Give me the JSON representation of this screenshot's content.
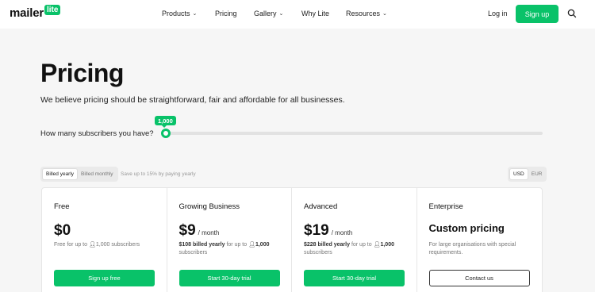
{
  "brand": {
    "word": "mailer",
    "badge": "lite",
    "accent": "#09c269"
  },
  "nav": {
    "items": [
      {
        "label": "Products",
        "dropdown": true
      },
      {
        "label": "Pricing",
        "dropdown": false
      },
      {
        "label": "Gallery",
        "dropdown": true
      },
      {
        "label": "Why Lite",
        "dropdown": false
      },
      {
        "label": "Resources",
        "dropdown": true
      }
    ],
    "login": "Log in",
    "signup": "Sign up",
    "search_icon": "search-icon"
  },
  "hero": {
    "title": "Pricing",
    "subtitle": "We believe pricing should be straightforward, fair and affordable for all businesses."
  },
  "slider": {
    "label": "How many subscribers you have?",
    "value": "1,000",
    "position_fraction": 0
  },
  "billing": {
    "options": [
      "Billed yearly",
      "Billed monthly"
    ],
    "selected": "Billed yearly",
    "note": "Save up to 15% by paying yearly"
  },
  "currency": {
    "options": [
      "USD",
      "EUR"
    ],
    "selected": "USD"
  },
  "plans": [
    {
      "name": "Free",
      "price": "$0",
      "period": "",
      "desc_prefix": "Free for up to",
      "desc_count": "1,000",
      "desc_suffix": "subscribers",
      "cta": "Sign up free"
    },
    {
      "name": "Growing Business",
      "price": "$9",
      "period": "/ month",
      "desc_prefix": "$108 billed yearly",
      "desc_mid": "for up to",
      "desc_count": "1,000",
      "desc_suffix": "subscribers",
      "cta": "Start 30-day trial"
    },
    {
      "name": "Advanced",
      "price": "$19",
      "period": "/ month",
      "desc_prefix": "$228 billed yearly",
      "desc_mid": "for up to",
      "desc_count": "1,000",
      "desc_suffix": "subscribers",
      "cta": "Start 30-day trial"
    },
    {
      "name": "Enterprise",
      "price": "Custom pricing",
      "period": "",
      "desc_prefix": "For large organisations with special requirements.",
      "cta": "Contact us"
    }
  ]
}
